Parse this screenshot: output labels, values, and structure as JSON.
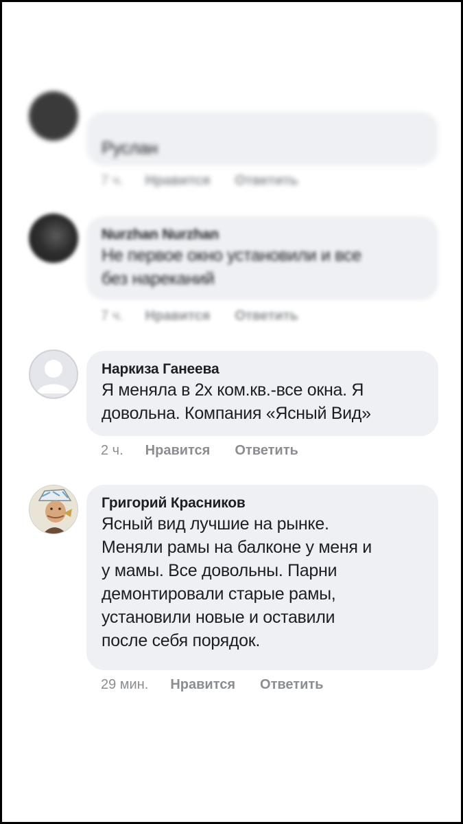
{
  "comments": [
    {
      "author": "",
      "lines": [
        "Руслан"
      ],
      "time": "7 ч.",
      "like": "Нравится",
      "reply": "Ответить",
      "blurred": true
    },
    {
      "author": "Nurzhan Nurzhan",
      "lines": [
        "Не первое окно установили и все",
        "без нареканий"
      ],
      "time": "7 ч.",
      "like": "Нравится",
      "reply": "Ответить",
      "blurred": true
    },
    {
      "author": "Наркиза Ганеева",
      "lines": [
        "Я меняла в 2х ком.кв.-все окна. Я",
        "довольна. Компания «Ясный Вид»"
      ],
      "time": "2 ч.",
      "like": "Нравится",
      "reply": "Ответить",
      "blurred": false
    },
    {
      "author": "Григорий Красников",
      "lines": [
        "Ясный вид лучшие на рынке.",
        "Меняли рамы на балконе у меня и",
        "у мамы. Все довольны. Парни",
        "демонтировали старые рамы,",
        "установили новые и оставили",
        "после себя порядок."
      ],
      "time": "29 мин.",
      "like": "Нравится",
      "reply": "Ответить",
      "blurred": false
    }
  ]
}
